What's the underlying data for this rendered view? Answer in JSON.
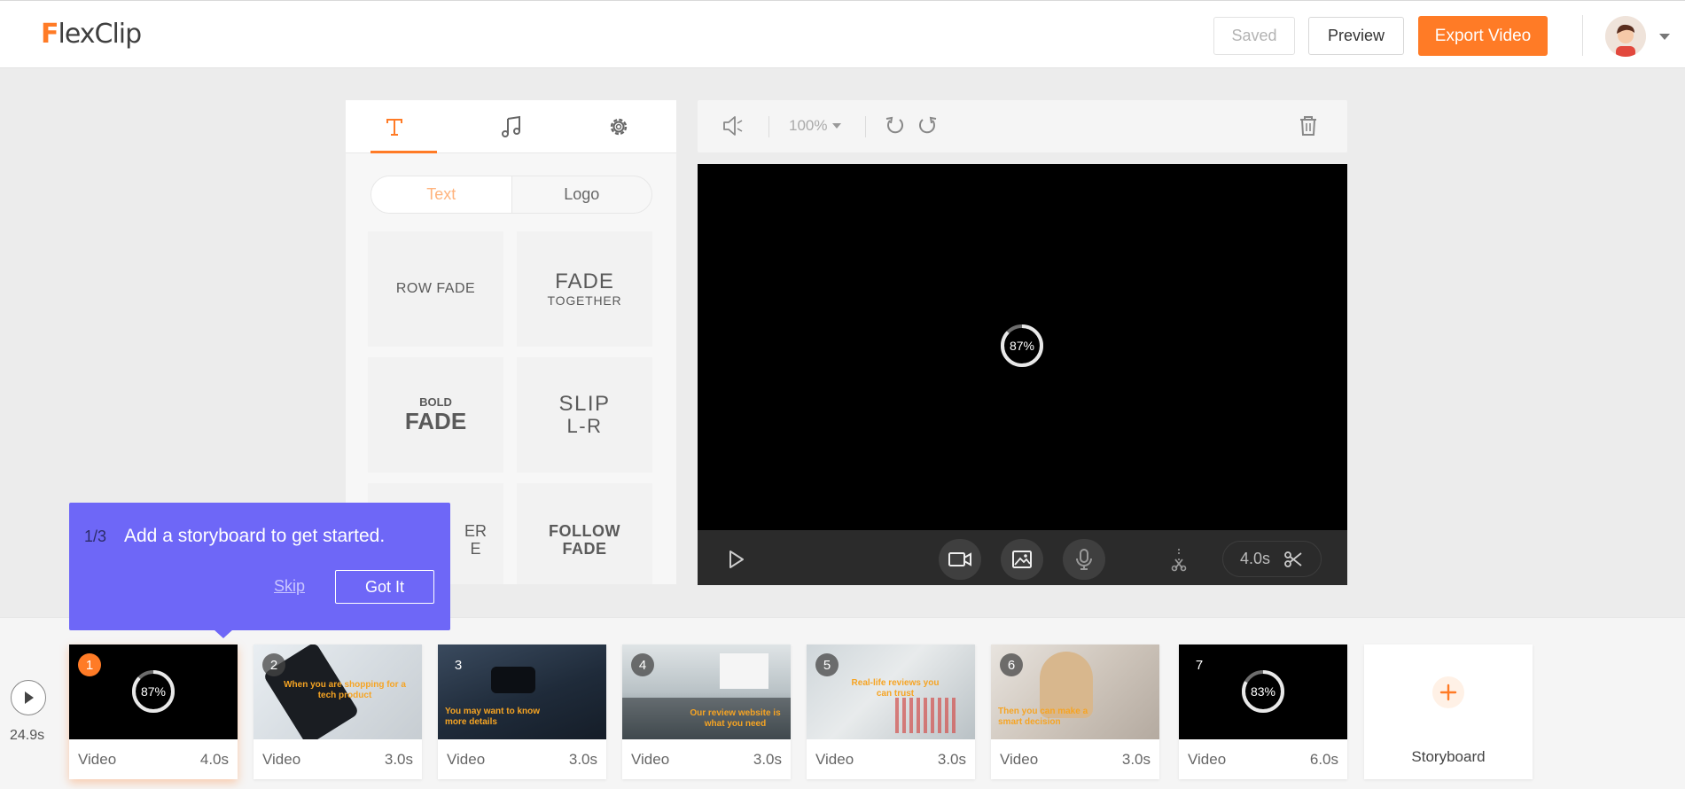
{
  "app": {
    "logo_f": "F",
    "logo_rest": "lexClip",
    "brand_color": "#ff7b26",
    "accent_purple": "#6e67f7"
  },
  "header": {
    "saved_label": "Saved",
    "preview_label": "Preview",
    "export_label": "Export Video",
    "avatar_icon": "user-avatar",
    "menu_icon": "chevron-down-icon"
  },
  "panel": {
    "tabs": [
      {
        "icon": "text-icon",
        "active": true
      },
      {
        "icon": "music-icon",
        "active": false
      },
      {
        "icon": "gear-icon",
        "active": false
      }
    ],
    "segments": [
      "Text",
      "Logo"
    ],
    "cards": [
      {
        "line1": "ROW FADE",
        "line2": ""
      },
      {
        "line1": "FADE",
        "line2": "TOGETHER"
      },
      {
        "line1": "BOLD",
        "line2": "FADE"
      },
      {
        "line1": "SLIP",
        "line2": "L-R"
      },
      {
        "line1": "ER",
        "line2": "E"
      },
      {
        "line1": "FOLLOW",
        "line2": "FADE"
      }
    ]
  },
  "toolbar": {
    "zoom_level": "100%",
    "icons": [
      "volume-icon",
      "undo-icon",
      "redo-icon",
      "trash-icon"
    ]
  },
  "player": {
    "loading_label": "87%",
    "loading_progress": 0.87,
    "duration_label": "4.0s",
    "control_icons": [
      "play-icon",
      "video-icon",
      "image-icon",
      "microphone-icon",
      "split-icon",
      "scissors-icon"
    ]
  },
  "timeline": {
    "total_label": "24.9s",
    "clips": [
      {
        "num": "1",
        "type": "Video",
        "duration": "4.0s",
        "caption": "",
        "loading": "87%",
        "progress": 0.87
      },
      {
        "num": "2",
        "type": "Video",
        "duration": "3.0s",
        "caption": "When you are shopping for a tech product"
      },
      {
        "num": "3",
        "type": "Video",
        "duration": "3.0s",
        "caption": "You may want to know more details"
      },
      {
        "num": "4",
        "type": "Video",
        "duration": "3.0s",
        "caption": "Our review website is what you need"
      },
      {
        "num": "5",
        "type": "Video",
        "duration": "3.0s",
        "caption": "Real-life reviews you can trust"
      },
      {
        "num": "6",
        "type": "Video",
        "duration": "3.0s",
        "caption": "Then you can make a smart decision"
      },
      {
        "num": "7",
        "type": "Video",
        "duration": "6.0s",
        "caption": "",
        "loading": "83%",
        "progress": 0.83
      }
    ],
    "add_label": "Storyboard"
  },
  "tooltip": {
    "step": "1/3",
    "message": "Add a storyboard to get started.",
    "skip_label": "Skip",
    "got_it_label": "Got It"
  }
}
